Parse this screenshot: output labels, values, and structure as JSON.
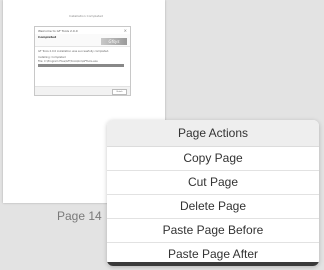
{
  "thumbnail": {
    "caption": "Installation Completed",
    "dialog": {
      "title": "Welcome to GF Tools 2.0.0",
      "heading": "Completed",
      "logo_text": "Gfsys",
      "lines": [
        "GF Tools 2.0.0 installation was successfully completed.",
        "Installing: Completed",
        "File: C:\\Program Files\\GF\\Tools\\bin\\GFTools.exe"
      ],
      "progress": 1.0,
      "button_label": "Finish"
    }
  },
  "page_label": "Page 14",
  "context_menu": {
    "header": "Page Actions",
    "items": [
      "Copy Page",
      "Cut Page",
      "Delete Page",
      "Paste Page Before",
      "Paste Page After"
    ]
  }
}
